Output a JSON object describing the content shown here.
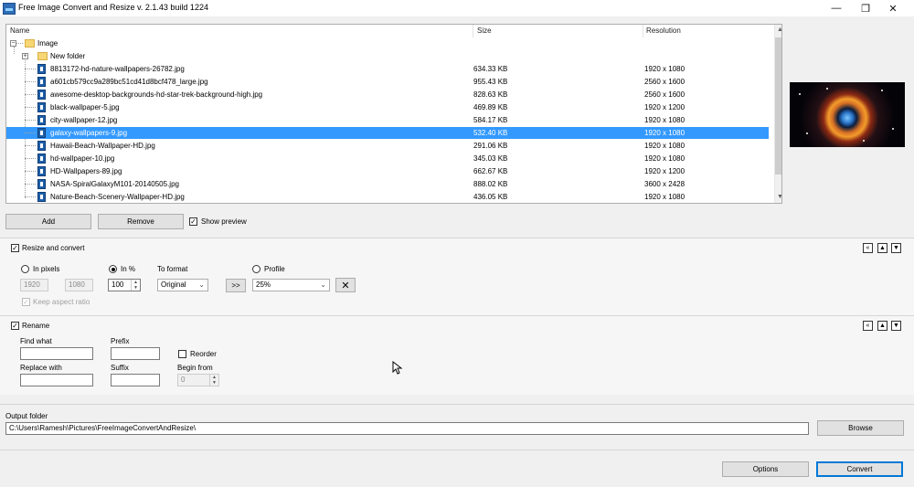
{
  "window": {
    "title": "Free Image Convert and Resize  v. 2.1.43 build 1224",
    "minimize": "—",
    "maximize": "❐",
    "close": "✕"
  },
  "tree": {
    "columns": [
      "Name",
      "Size",
      "Resolution"
    ],
    "root_label": "Image",
    "subfolder_label": "New folder",
    "files": [
      {
        "name": "8813172-hd-nature-wallpapers-26782.jpg",
        "size": "634.33 KB",
        "res": "1920 x 1080"
      },
      {
        "name": "a601cb579cc9a289bc51cd41d8bcf478_large.jpg",
        "size": "955.43 KB",
        "res": "2560 x 1600"
      },
      {
        "name": "awesome-desktop-backgrounds-hd-star-trek-background-high.jpg",
        "size": "828.63 KB",
        "res": "2560 x 1600"
      },
      {
        "name": "black-wallpaper-5.jpg",
        "size": "469.89 KB",
        "res": "1920 x 1200"
      },
      {
        "name": "city-wallpaper-12.jpg",
        "size": "584.17 KB",
        "res": "1920 x 1080"
      },
      {
        "name": "galaxy-wallpapers-9.jpg",
        "size": "532.40 KB",
        "res": "1920 x 1080",
        "selected": true
      },
      {
        "name": "Hawaii-Beach-Wallpaper-HD.jpg",
        "size": "291.06 KB",
        "res": "1920 x 1080"
      },
      {
        "name": "hd-wallpaper-10.jpg",
        "size": "345.03 KB",
        "res": "1920 x 1080"
      },
      {
        "name": "HD-Wallpapers-89.jpg",
        "size": "662.67 KB",
        "res": "1920 x 1200"
      },
      {
        "name": "NASA-SpiralGalaxyM101-20140505.jpg",
        "size": "888.02 KB",
        "res": "3600 x 2428"
      },
      {
        "name": "Nature-Beach-Scenery-Wallpaper-HD.jpg",
        "size": "436.05 KB",
        "res": "1920 x 1080"
      }
    ]
  },
  "actions": {
    "add": "Add",
    "remove": "Remove",
    "show_preview": "Show preview",
    "show_preview_checked": true
  },
  "resize": {
    "header": "Resize and convert",
    "in_pixels": "In pixels",
    "in_percent": "In %",
    "to_format": "To format",
    "profile": "Profile",
    "width": "1920",
    "height": "1080",
    "percent": "100",
    "format": "Original",
    "arrow_button": ">>",
    "profile_value": "25%",
    "keep_aspect": "Keep aspect ratio"
  },
  "rename": {
    "header": "Rename",
    "find_what": "Find what",
    "prefix": "Prefix",
    "reorder": "Reorder",
    "replace_with": "Replace with",
    "suffix": "Suffix",
    "begin_from": "Begin from",
    "begin_value": "0"
  },
  "output": {
    "label": "Output folder",
    "path": "C:\\Users\\Ramesh\\Pictures\\FreeImageConvertAndResize\\",
    "browse": "Browse"
  },
  "footer": {
    "options": "Options",
    "convert": "Convert"
  },
  "section_controls": {
    "collapse_all": "«",
    "up": "▲",
    "down": "▼"
  },
  "colors": {
    "selection": "#3399ff",
    "accent": "#0078d7"
  }
}
